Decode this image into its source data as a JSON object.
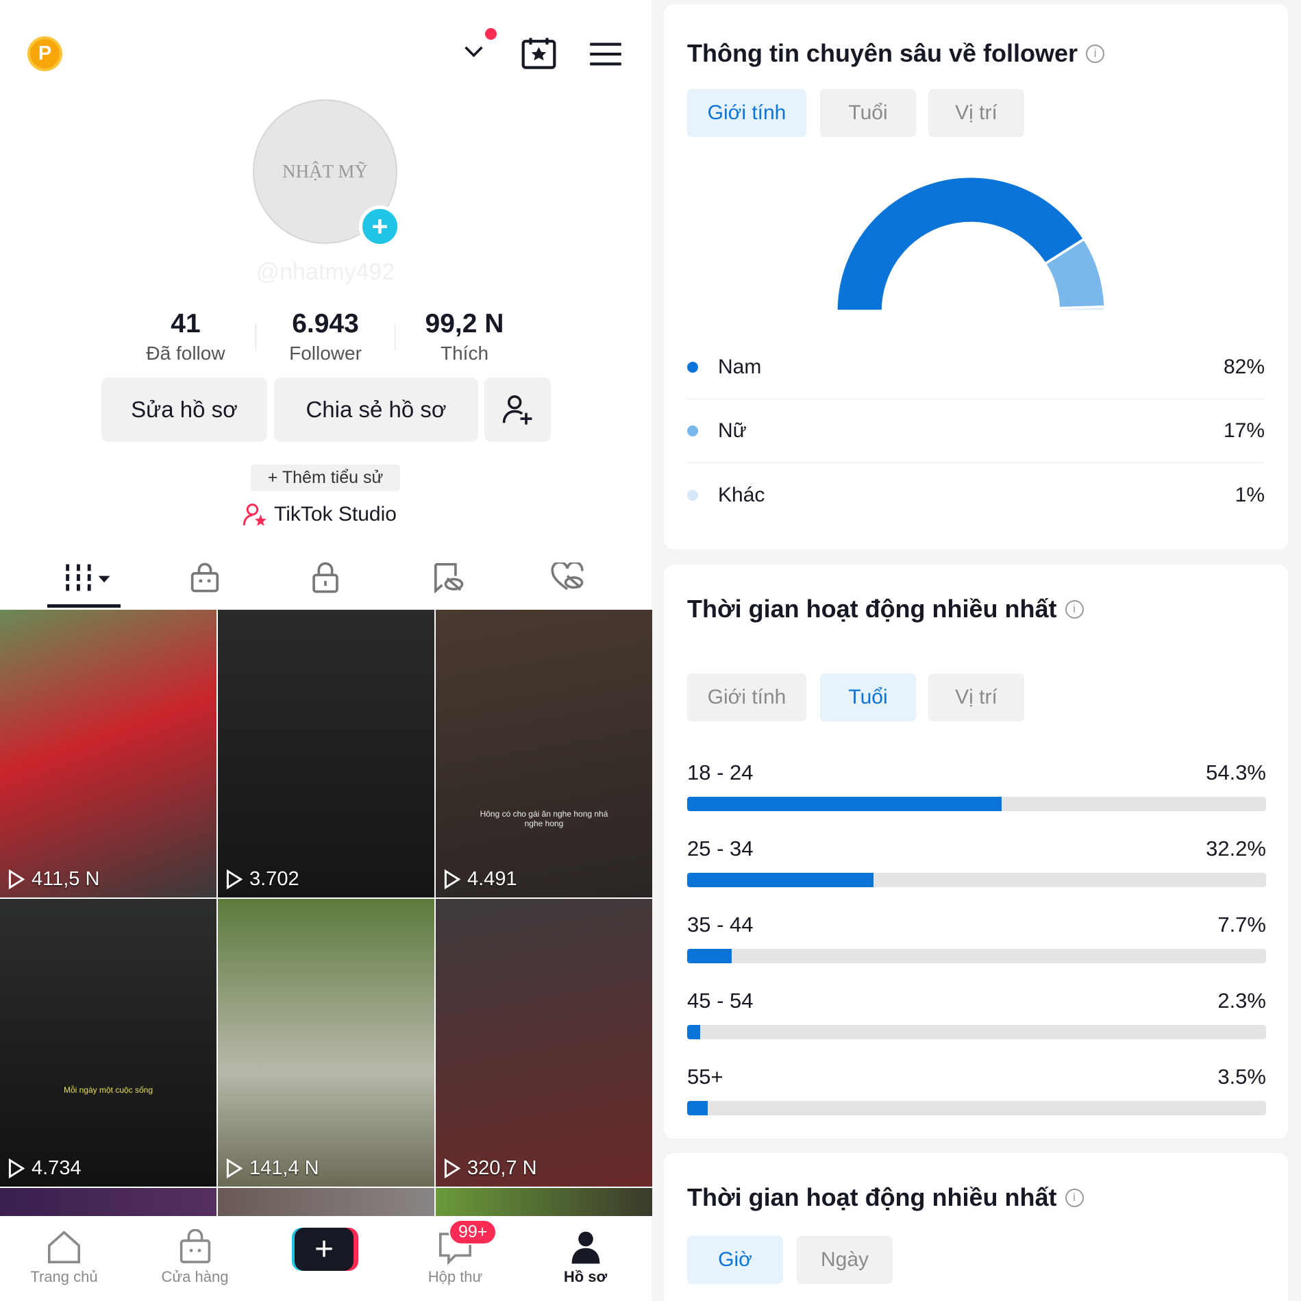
{
  "header": {
    "coin_label": "P",
    "icons": [
      "chevron-down-icon",
      "calendar-star-icon",
      "menu-icon"
    ]
  },
  "profile": {
    "avatar_text": "NHẬT MỸ",
    "username": "@nhatmy492",
    "stats": [
      {
        "value": "41",
        "label": "Đã follow"
      },
      {
        "value": "6.943",
        "label": "Follower"
      },
      {
        "value": "99,2 N",
        "label": "Thích"
      }
    ],
    "edit_label": "Sửa hồ sơ",
    "share_label": "Chia sẻ hồ sơ",
    "add_bio_label": "+ Thêm tiểu sử",
    "studio_label": "TikTok Studio"
  },
  "content_tabs": [
    "videos-grid-icon",
    "shop-bag-icon",
    "lock-icon",
    "bookmark-hidden-icon",
    "heart-hidden-icon"
  ],
  "videos": [
    {
      "views": "411,5 N"
    },
    {
      "views": "3.702"
    },
    {
      "views": "4.491",
      "caption": "Hông có cho gái ăn nghe hong nhá nghe hong"
    },
    {
      "views": "4.734",
      "caption": "Mỗi ngày một cuộc sống"
    },
    {
      "views": "141,4 N"
    },
    {
      "views": "320,7 N"
    },
    {},
    {},
    {}
  ],
  "bottom_nav": [
    {
      "label": "Trang chủ"
    },
    {
      "label": "Cửa hàng"
    },
    {
      "label": ""
    },
    {
      "label": "Hộp thư",
      "badge": "99+"
    },
    {
      "label": "Hồ sơ"
    }
  ],
  "insights": {
    "title": "Thông tin chuyên sâu về follower",
    "tabs": [
      "Giới tính",
      "Tuổi",
      "Vị trí"
    ],
    "active": "Giới tính",
    "gender": [
      {
        "label": "Nam",
        "value": "82%",
        "pct": 82,
        "color": "#0b74d9"
      },
      {
        "label": "Nữ",
        "value": "17%",
        "pct": 17,
        "color": "#7ab8ec"
      },
      {
        "label": "Khác",
        "value": "1%",
        "pct": 1,
        "color": "#d6e8f8"
      }
    ]
  },
  "activity": {
    "title": "Thời gian hoạt động nhiều nhất",
    "tabs": [
      "Giới tính",
      "Tuổi",
      "Vị trí"
    ],
    "active": "Tuổi",
    "ages": [
      {
        "label": "18 - 24",
        "value": "54.3%",
        "pct": 54.3
      },
      {
        "label": "25 - 34",
        "value": "32.2%",
        "pct": 32.2
      },
      {
        "label": "35 - 44",
        "value": "7.7%",
        "pct": 7.7
      },
      {
        "label": "45 - 54",
        "value": "2.3%",
        "pct": 2.3
      },
      {
        "label": "55+",
        "value": "3.5%",
        "pct": 3.5
      }
    ]
  },
  "activity2": {
    "title": "Thời gian hoạt động nhiều nhất",
    "tabs": [
      "Giờ",
      "Ngày"
    ],
    "active": "Giờ"
  },
  "colors": {
    "accent": "#0b74d9",
    "pink": "#fe2c55",
    "cyan": "#20c4e4"
  }
}
